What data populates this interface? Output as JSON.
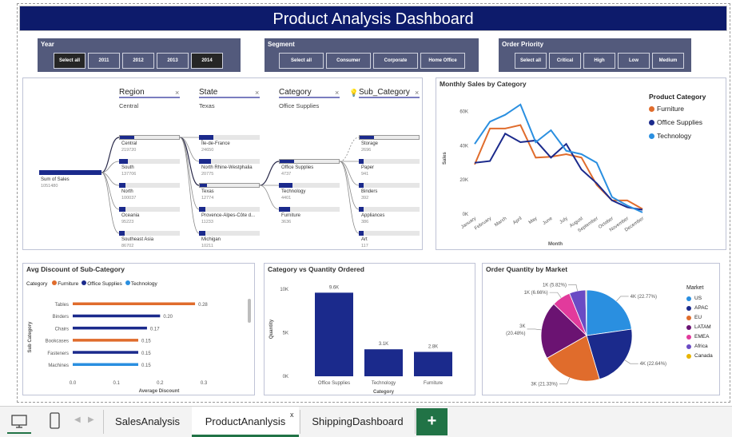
{
  "title": "Product Analysis Dashboard",
  "slicers": {
    "year": {
      "label": "Year",
      "options": [
        "Select all",
        "2011",
        "2012",
        "2013",
        "2014"
      ]
    },
    "segment": {
      "label": "Segment",
      "options": [
        "Select all",
        "Consumer",
        "Corporate",
        "Home Office"
      ]
    },
    "priority": {
      "label": "Order Priority",
      "options": [
        "Select all",
        "Critical",
        "High",
        "Low",
        "Medium"
      ]
    }
  },
  "decomp": {
    "headers": [
      {
        "title": "Region",
        "sub": "Central"
      },
      {
        "title": "State",
        "sub": "Texas"
      },
      {
        "title": "Category",
        "sub": "Office Supplies"
      },
      {
        "title": "Sub_Category",
        "sub": ""
      }
    ],
    "close": "×",
    "root": {
      "label": "Sum of Sales",
      "value": "1051480"
    },
    "regions": [
      {
        "label": "Central",
        "value": "219720"
      },
      {
        "label": "South",
        "value": "137706"
      },
      {
        "label": "North",
        "value": "100037"
      },
      {
        "label": "Oceania",
        "value": "95223"
      },
      {
        "label": "Southeast Asia",
        "value": "86702"
      }
    ],
    "states": [
      {
        "label": "Île-de-France",
        "value": "24650"
      },
      {
        "label": "North Rhine-Westphalia",
        "value": "20775"
      },
      {
        "label": "Texas",
        "value": "12774"
      },
      {
        "label": "Provence-Alpes-Côte d...",
        "value": "11233"
      },
      {
        "label": "Michigan",
        "value": "10211"
      }
    ],
    "categories": [
      {
        "label": "Office Supplies",
        "value": "4737"
      },
      {
        "label": "Technology",
        "value": "4401"
      },
      {
        "label": "Furniture",
        "value": "3636"
      }
    ],
    "subcategories": [
      {
        "label": "Storage",
        "value": "2696"
      },
      {
        "label": "Paper",
        "value": "941"
      },
      {
        "label": "Binders",
        "value": "392"
      },
      {
        "label": "Appliances",
        "value": "386"
      },
      {
        "label": "Art",
        "value": "117"
      }
    ]
  },
  "monthly": {
    "title": "Monthly Sales by Category",
    "legend_title": "Product Category",
    "xlabel": "Month",
    "ylabel": "Sales"
  },
  "avg_discount": {
    "title": "Avg Discount of Sub-Category",
    "legend_label": "Category",
    "ylabel": "Sub Category",
    "xlabel": "Average Discount"
  },
  "cat_qty": {
    "title": "Category vs Quantity Ordered",
    "ylabel": "Quantity",
    "xlabel": "Category"
  },
  "market": {
    "title": "Order Quantity by Market",
    "legend_title": "Market"
  },
  "chart_data": [
    {
      "type": "line",
      "title": "Monthly Sales by Category",
      "xlabel": "Month",
      "ylabel": "Sales",
      "ylim": [
        0,
        70000
      ],
      "yticks": [
        "0K",
        "20K",
        "40K",
        "60K"
      ],
      "x": [
        "January",
        "February",
        "March",
        "April",
        "May",
        "June",
        "July",
        "August",
        "September",
        "October",
        "November",
        "December"
      ],
      "series": [
        {
          "name": "Furniture",
          "color": "#e06c2c",
          "values": [
            29000,
            50000,
            50000,
            52000,
            33000,
            33500,
            35000,
            33000,
            17000,
            8000,
            8000,
            3000
          ]
        },
        {
          "name": "Office Supplies",
          "color": "#1b2a8c",
          "values": [
            30000,
            31000,
            47000,
            42000,
            43000,
            33000,
            41000,
            26000,
            18000,
            8000,
            4000,
            2500
          ]
        },
        {
          "name": "Technology",
          "color": "#2a8fe0",
          "values": [
            41000,
            54000,
            58000,
            64000,
            42000,
            49000,
            37000,
            35000,
            30000,
            10000,
            5000,
            1000
          ]
        }
      ],
      "legend": "top-right"
    },
    {
      "type": "bar",
      "orientation": "horizontal",
      "title": "Avg Discount of Sub-Category",
      "xlabel": "Average Discount",
      "ylabel": "Sub Category",
      "xlim": [
        0,
        0.3
      ],
      "xticks": [
        "0.0",
        "0.1",
        "0.2",
        "0.3"
      ],
      "categories": [
        "Tables",
        "Binders",
        "Chairs",
        "Bookcases",
        "Fasteners",
        "Machines"
      ],
      "values": [
        0.28,
        0.2,
        0.17,
        0.15,
        0.15,
        0.15
      ],
      "labels": [
        "0.28",
        "0.20",
        "0.17",
        "0.15",
        "0.15",
        "0.15"
      ],
      "colors": [
        "#e06c2c",
        "#1b2a8c",
        "#1b2a8c",
        "#e06c2c",
        "#1b2a8c",
        "#2a8fe0"
      ],
      "series": [
        {
          "name": "Furniture",
          "color": "#e06c2c"
        },
        {
          "name": "Office Supplies",
          "color": "#1b2a8c"
        },
        {
          "name": "Technology",
          "color": "#2a8fe0"
        }
      ]
    },
    {
      "type": "bar",
      "title": "Category vs Quantity Ordered",
      "xlabel": "Category",
      "ylabel": "Quantity",
      "ylim": [
        0,
        10000
      ],
      "yticks": [
        "0K",
        "5K",
        "10K"
      ],
      "categories": [
        "Office Supplies",
        "Technology",
        "Furniture"
      ],
      "values": [
        9600,
        3100,
        2800
      ],
      "labels": [
        "9.6K",
        "3.1K",
        "2.8K"
      ]
    },
    {
      "type": "pie",
      "title": "Order Quantity by Market",
      "legend_title": "Market",
      "slices": [
        {
          "name": "US",
          "value": 22.77,
          "label": "4K (22.77%)",
          "color": "#2a8fe0"
        },
        {
          "name": "APAC",
          "value": 22.64,
          "label": "4K (22.64%)",
          "color": "#1b2a8c"
        },
        {
          "name": "EU",
          "value": 21.33,
          "label": "3K (21.33%)",
          "color": "#e06c2c"
        },
        {
          "name": "LATAM",
          "value": 20.48,
          "label": "3K (20.48%)",
          "color": "#6b1372"
        },
        {
          "name": "EMEA",
          "value": 6.66,
          "label": "1K (6.66%)",
          "color": "#e23a9c"
        },
        {
          "name": "Africa",
          "value": 5.82,
          "label": "1K (5.82%)",
          "color": "#6a4bc4"
        },
        {
          "name": "Canada",
          "value": 0.3,
          "label": "",
          "color": "#e8b400"
        }
      ]
    }
  ],
  "tabs": {
    "desktop_icon": "desktop-icon",
    "phone_icon": "phone-icon",
    "items": [
      "SalesAnalysis",
      "ProductAnanlysis",
      "ShippingDashboard"
    ],
    "close": "x",
    "add": "+",
    "accent": "#217346"
  }
}
